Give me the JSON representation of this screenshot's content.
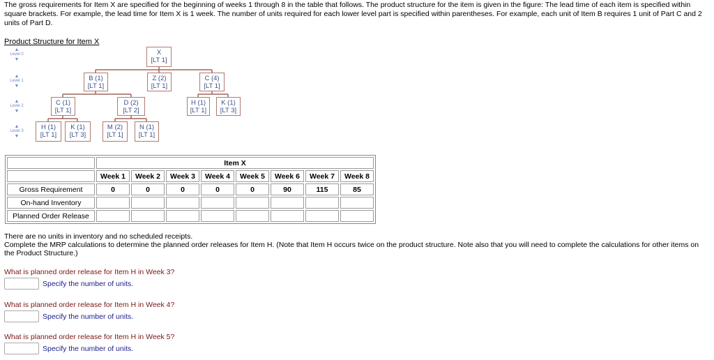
{
  "intro": "The gross requirements for Item X are specified for the beginning of weeks 1 through 8 in the table that follows. The product structure for the item is given in the figure: The lead time of each item is specified within square brackets. For example, the lead time for Item X is 1 week. The number of units required for each lower level part is specified within parentheses. For example, each unit of Item B requires 1 unit of Part C and 2 units of Part D.",
  "product_structure": {
    "title": "Product Structure for Item X",
    "levels": [
      "Level 0",
      "Level 1",
      "Level 2",
      "Level 3"
    ],
    "nodes": [
      {
        "id": "x",
        "name": "X",
        "lt": "[LT 1]"
      },
      {
        "id": "b",
        "name": "B (1)",
        "lt": "[LT 1]"
      },
      {
        "id": "z",
        "name": "Z (2)",
        "lt": "[LT 1]"
      },
      {
        "id": "c4",
        "name": "C (4)",
        "lt": "[LT 1]"
      },
      {
        "id": "c1",
        "name": "C (1)",
        "lt": "[LT 1]"
      },
      {
        "id": "d",
        "name": "D (2)",
        "lt": "[LT 2]"
      },
      {
        "id": "h_right",
        "name": "H (1)",
        "lt": "[LT 1]"
      },
      {
        "id": "k_right",
        "name": "K (1)",
        "lt": "[LT 3]"
      },
      {
        "id": "h_left",
        "name": "H (1)",
        "lt": "[LT 1]"
      },
      {
        "id": "k_left",
        "name": "K (1)",
        "lt": "[LT 3]"
      },
      {
        "id": "m",
        "name": "M (2)",
        "lt": "[LT 1]"
      },
      {
        "id": "n",
        "name": "N (1)",
        "lt": "[LT 1]"
      }
    ]
  },
  "table": {
    "title": "Item X",
    "weeks": [
      "Week 1",
      "Week 2",
      "Week 3",
      "Week 4",
      "Week 5",
      "Week 6",
      "Week 7",
      "Week 8"
    ],
    "rows": [
      {
        "label": "Gross Requirement",
        "values": [
          "0",
          "0",
          "0",
          "0",
          "0",
          "90",
          "115",
          "85"
        ]
      },
      {
        "label": "On-hand Inventory",
        "values": [
          "",
          "",
          "",
          "",
          "",
          "",
          "",
          ""
        ]
      },
      {
        "label": "Planned Order Release",
        "values": [
          "",
          "",
          "",
          "",
          "",
          "",
          "",
          ""
        ]
      }
    ]
  },
  "notes": {
    "line1": "There are no units in inventory and no scheduled receipts.",
    "line2": "Complete the MRP calculations to determine the planned order releases for Item H. (Note that Item H occurs twice on the product structure. Note also that you will need to complete the calculations for other items on the Product Structure.)"
  },
  "questions": [
    {
      "text": "What is planned order release for Item H in Week 3?",
      "value": "",
      "hint": "Specify the number of units."
    },
    {
      "text": "What is planned order release for Item H in Week 4?",
      "value": "",
      "hint": "Specify the number of units."
    },
    {
      "text": "What is planned order release for Item H in Week 5?",
      "value": "",
      "hint": "Specify the number of units."
    }
  ]
}
